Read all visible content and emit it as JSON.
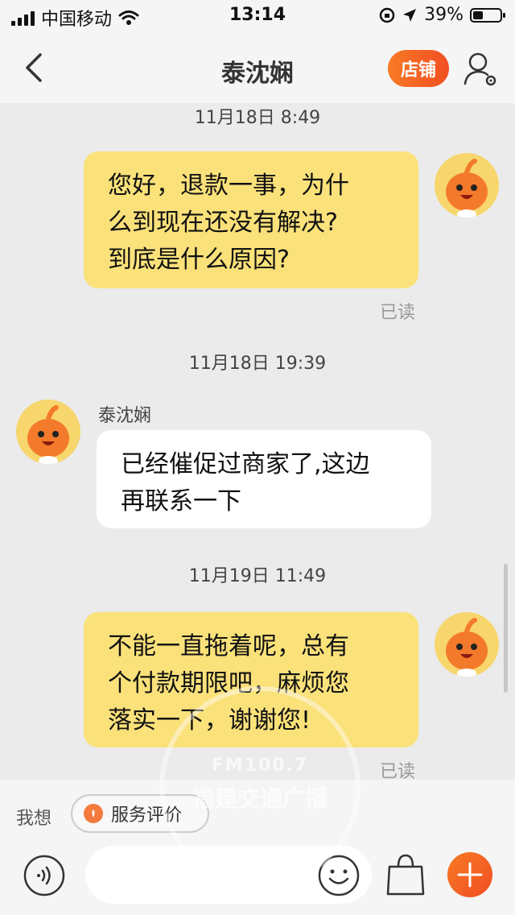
{
  "status": {
    "carrier": "中国移动",
    "time": "13:14",
    "battery_text": "39%",
    "battery_level": 0.39
  },
  "nav": {
    "title": "泰沈娴",
    "shop_label": "店铺"
  },
  "messages": [
    {
      "timestamp": "11月18日 8:49",
      "side": "me",
      "text_lines": [
        "您好，退款一事，为什",
        "么到现在还没有解决?",
        "到底是什么原因?"
      ],
      "read": "已读"
    },
    {
      "timestamp": "11月18日 19:39",
      "side": "them",
      "sender": "泰沈娴",
      "text_lines": [
        "已经催促过商家了,这边",
        "再联系一下"
      ]
    },
    {
      "timestamp": "11月19日 11:49",
      "side": "me",
      "text_lines": [
        "不能一直拖着呢，总有",
        "个付款期限吧，麻烦您",
        "落实一下，谢谢您!"
      ],
      "read": "已读"
    }
  ],
  "suggest": {
    "label": "我想",
    "chip": "服务评价"
  },
  "watermark": {
    "line1": "FM100.7",
    "line2": "福建交通广播"
  },
  "colors": {
    "accent": "#f56a23",
    "my_bubble": "#fae17a",
    "their_bubble": "#ffffff",
    "chat_bg": "#ebebeb"
  }
}
